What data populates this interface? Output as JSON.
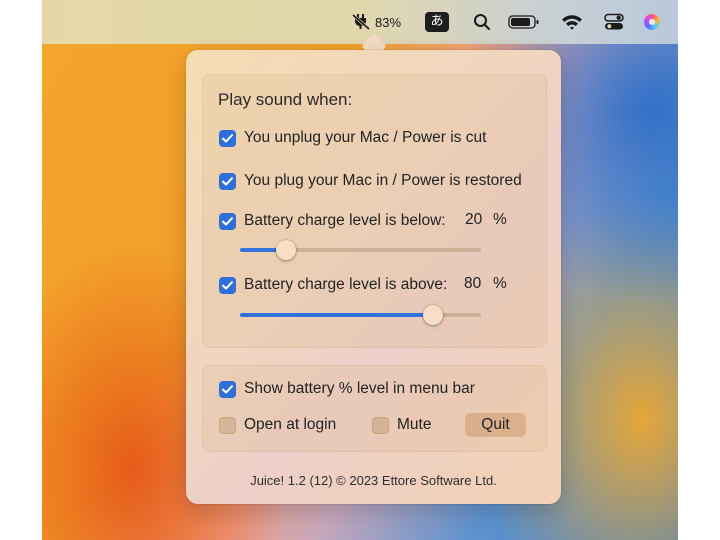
{
  "menubar": {
    "battery_percent": "83%",
    "input_source_label": "あ",
    "icons": [
      "charging-plug-icon",
      "input-source-icon",
      "search-icon",
      "battery-icon",
      "wifi-icon",
      "control-center-icon",
      "siri-icon"
    ]
  },
  "popover": {
    "section_title": "Play sound when:",
    "options": {
      "unplug": {
        "label": "You unplug your Mac / Power is cut",
        "checked": true
      },
      "plug_in": {
        "label": "You plug your Mac in / Power is restored",
        "checked": true
      },
      "below": {
        "label": "Battery charge level is below:",
        "checked": true,
        "value": "20",
        "unit": "%",
        "slider_level": 0.19
      },
      "above": {
        "label": "Battery charge level is above:",
        "checked": true,
        "value": "80",
        "unit": "%",
        "slider_level": 0.8
      }
    },
    "settings": {
      "show_percent": {
        "label": "Show battery % level in menu bar",
        "checked": true
      },
      "open_at_login": {
        "label": "Open at login",
        "checked": false
      },
      "mute": {
        "label": "Mute",
        "checked": false
      },
      "quit_label": "Quit"
    },
    "footer": "Juice! 1.2 (12) © 2023 Ettore Software Ltd."
  },
  "colors": {
    "accent": "#2f6fd8",
    "popover_bg": "#f2dcc3"
  }
}
